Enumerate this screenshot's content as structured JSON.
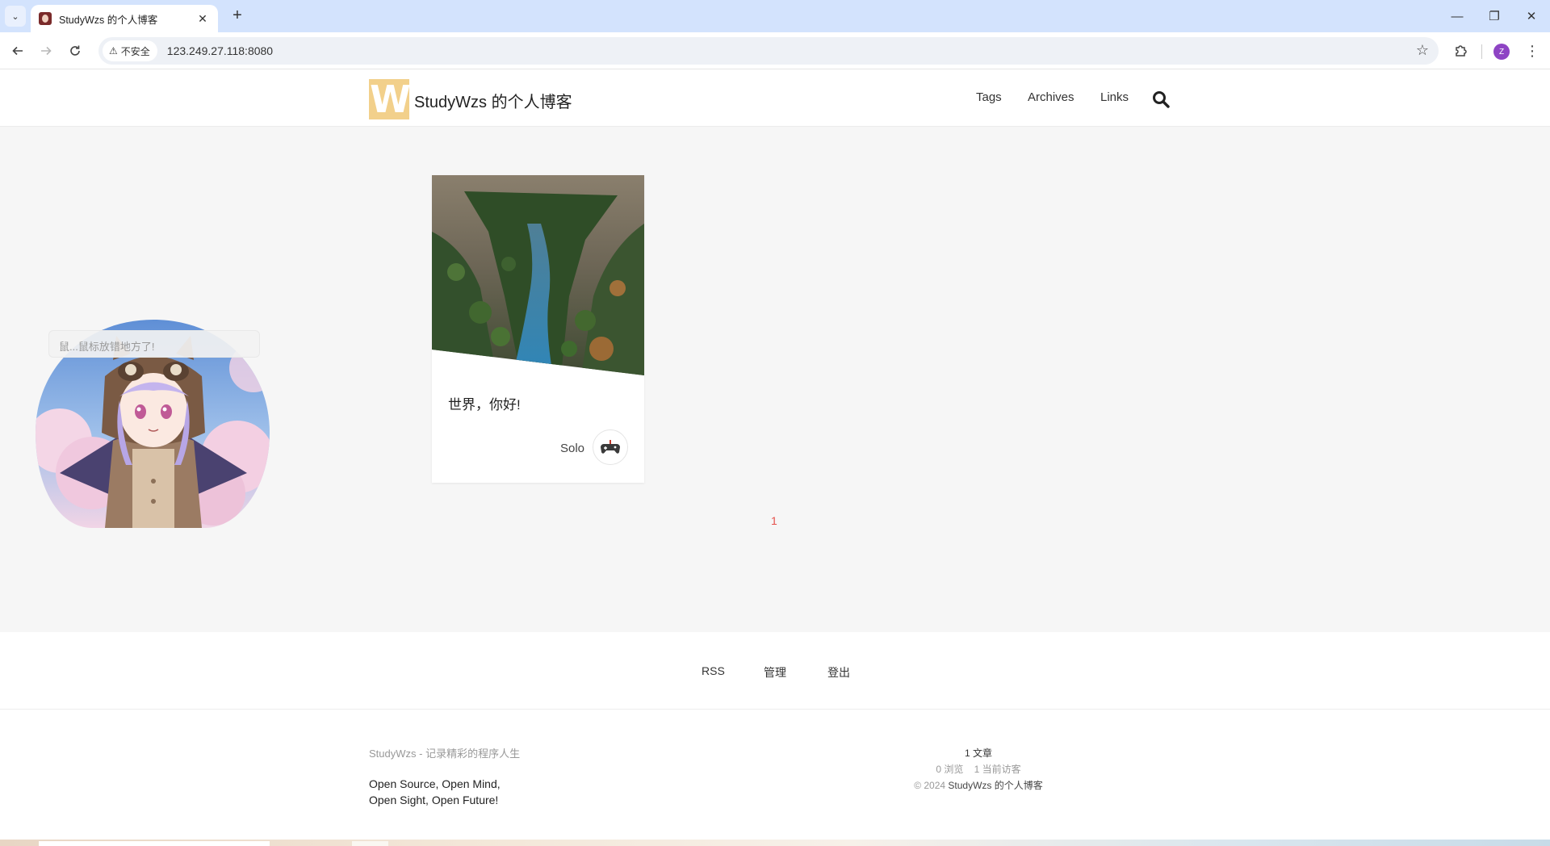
{
  "browser": {
    "tab_title": "StudyWzs 的个人博客",
    "security_label": "不安全",
    "url": "123.249.27.118:8080",
    "profile_initial": "Z"
  },
  "site": {
    "logo_letter": "W",
    "title": "StudyWzs 的个人博客",
    "nav": {
      "tags": "Tags",
      "archives": "Archives",
      "links": "Links"
    }
  },
  "article": {
    "title": "世界，你好!",
    "author": "Solo"
  },
  "pagination": {
    "current": "1"
  },
  "mascot": {
    "tip": "鼠...鼠标放错地方了!"
  },
  "footer": {
    "links": {
      "rss": "RSS",
      "admin": "管理",
      "logout": "登出"
    },
    "tagline": "StudyWzs - 记录精彩的程序人生",
    "motto_line1": "Open Source, Open Mind,",
    "motto_line2": "Open Sight, Open Future!",
    "stats": {
      "articles": "1 文章",
      "views": "0 浏览",
      "visitors": "1 当前访客",
      "copyright_prefix": "© 2024",
      "copyright_brand": "StudyWzs 的个人博客"
    }
  },
  "colors": {
    "accent": "#e5514c",
    "logo_bg": "#f2d08b",
    "page_bg": "#f6f6f6"
  }
}
